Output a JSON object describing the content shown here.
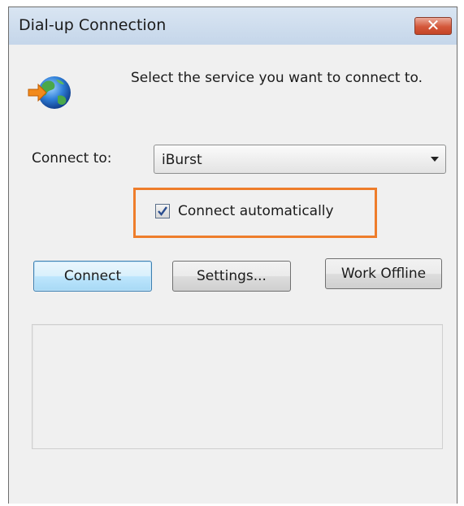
{
  "window": {
    "title": "Dial-up Connection",
    "close_label": "✕"
  },
  "prompt": "Select the service you want to connect to.",
  "connect_to": {
    "label": "Connect to:",
    "selected": "iBurst"
  },
  "auto_connect": {
    "label": "Connect automatically",
    "checked": true
  },
  "buttons": {
    "connect": "Connect",
    "settings": "Settings...",
    "work_offline": "Work Offline"
  },
  "colors": {
    "highlight": "#ee7d2b",
    "close_button": "#d4573a",
    "default_button_border": "#3c7fb1"
  },
  "icons": {
    "app": "dialup-globe-icon",
    "check": "checkmark-icon",
    "dropdown": "chevron-down-icon"
  }
}
